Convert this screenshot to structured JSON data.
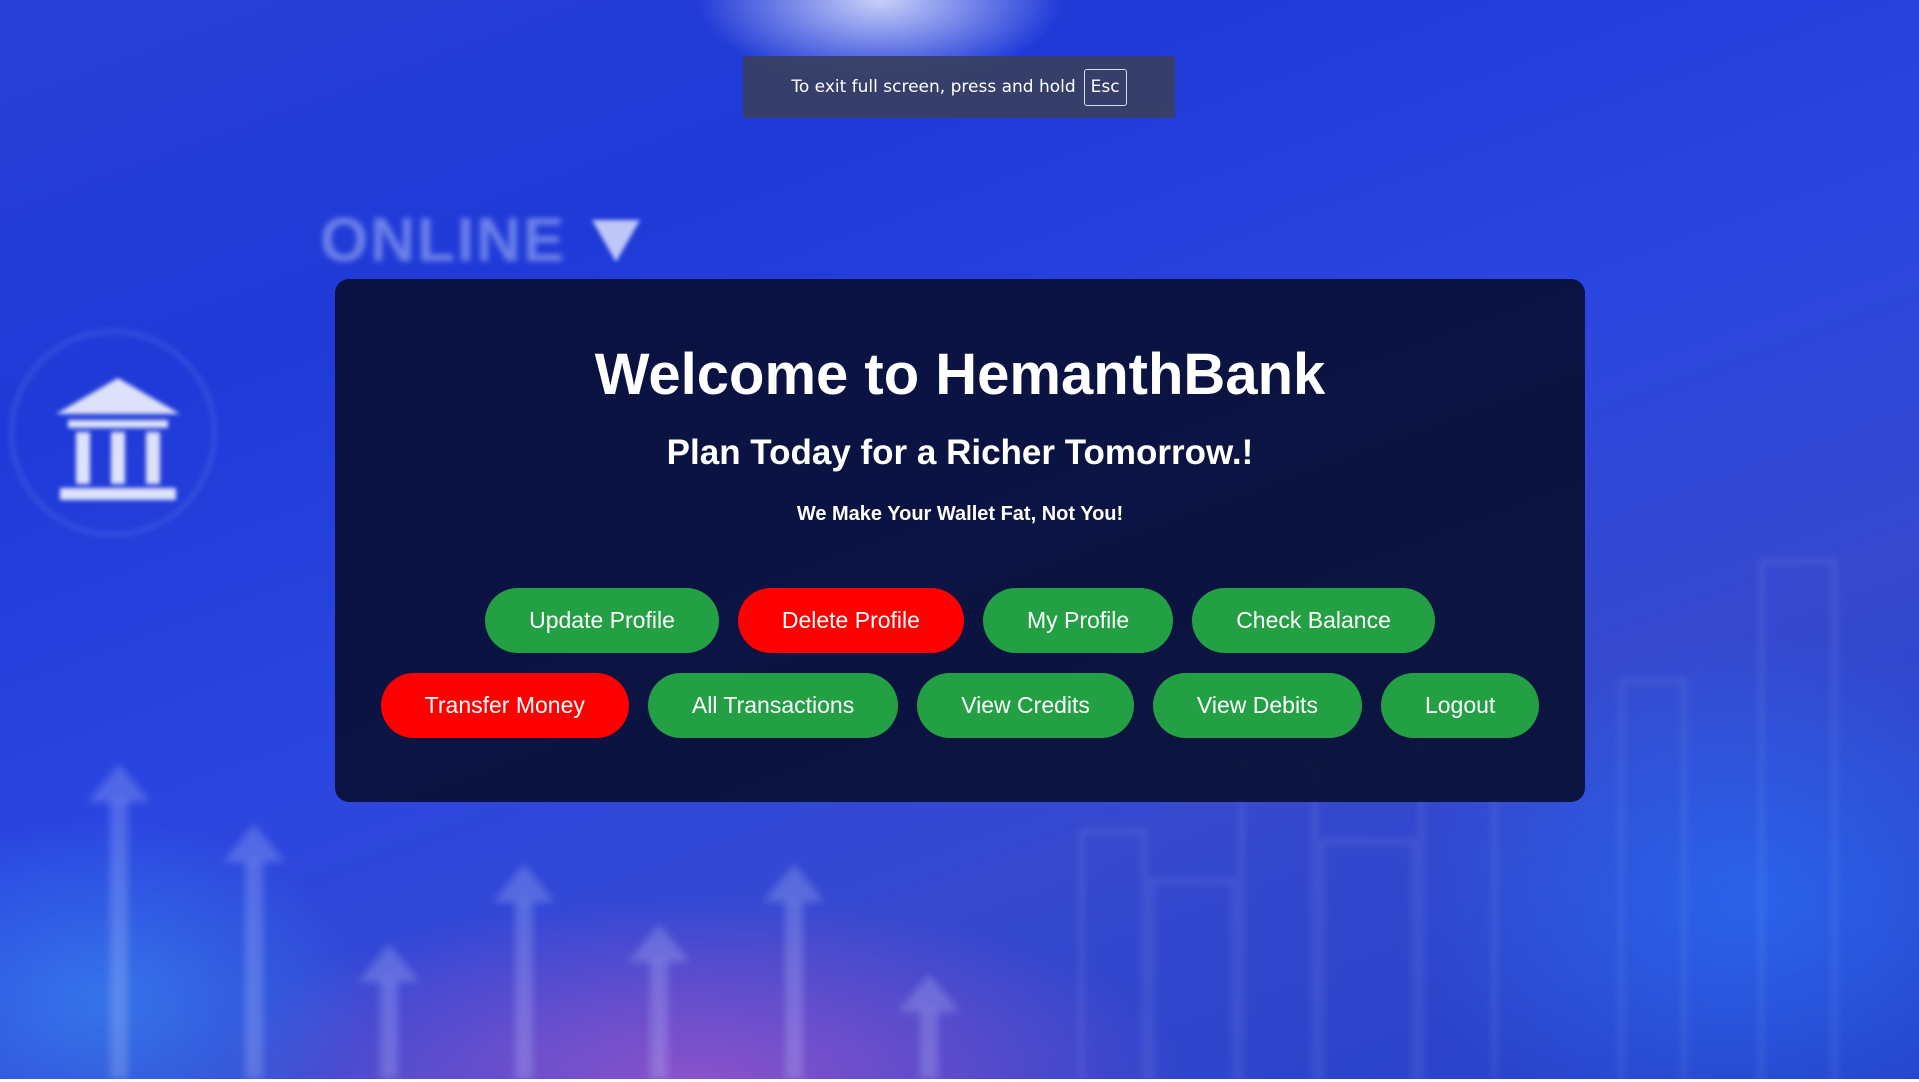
{
  "fullscreen_notice": {
    "text": "To exit full screen, press and hold",
    "key": "Esc"
  },
  "panel": {
    "title": "Welcome to HemanthBank",
    "subtitle": "Plan Today for a Richer Tomorrow.!",
    "tagline": "We Make Your Wallet Fat, Not You!"
  },
  "buttons_row1": [
    {
      "label": "Update Profile",
      "color": "#22a043"
    },
    {
      "label": "Delete Profile",
      "color": "#ff0000"
    },
    {
      "label": "My Profile",
      "color": "#22a043"
    },
    {
      "label": "Check Balance",
      "color": "#22a043"
    }
  ],
  "buttons_row2": [
    {
      "label": "Transfer Money",
      "color": "#ff0000"
    },
    {
      "label": "All Transactions",
      "color": "#22a043"
    },
    {
      "label": "View Credits",
      "color": "#22a043"
    },
    {
      "label": "View Debits",
      "color": "#22a043"
    },
    {
      "label": "Logout",
      "color": "#22a043"
    }
  ],
  "background": {
    "text": "ONLINE",
    "icon": "bank-icon"
  }
}
